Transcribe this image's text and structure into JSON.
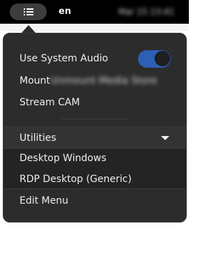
{
  "topbar": {
    "activities_icon": "menu-list-icon",
    "language": "en",
    "clock": "Mar 15 23:41"
  },
  "menu": {
    "system_audio": {
      "label": "Use System Audio",
      "toggle_on": true,
      "toggle_color": "#2d5fb5"
    },
    "mount": {
      "label": "Mount",
      "blurred_suffix": "Unmount Media Store"
    },
    "stream": {
      "label": "Stream CAM"
    },
    "utilities": {
      "label": "Utilities",
      "expanded": true,
      "items": [
        {
          "label": "Desktop Windows"
        },
        {
          "label": "RDP Desktop (Generic)"
        }
      ]
    },
    "edit": {
      "label": "Edit Menu"
    }
  },
  "colors": {
    "menu_bg": "#2c2c2c",
    "submenu_bg": "#242424",
    "topbar_bg": "#000000",
    "accent": "#2d5fb5"
  }
}
